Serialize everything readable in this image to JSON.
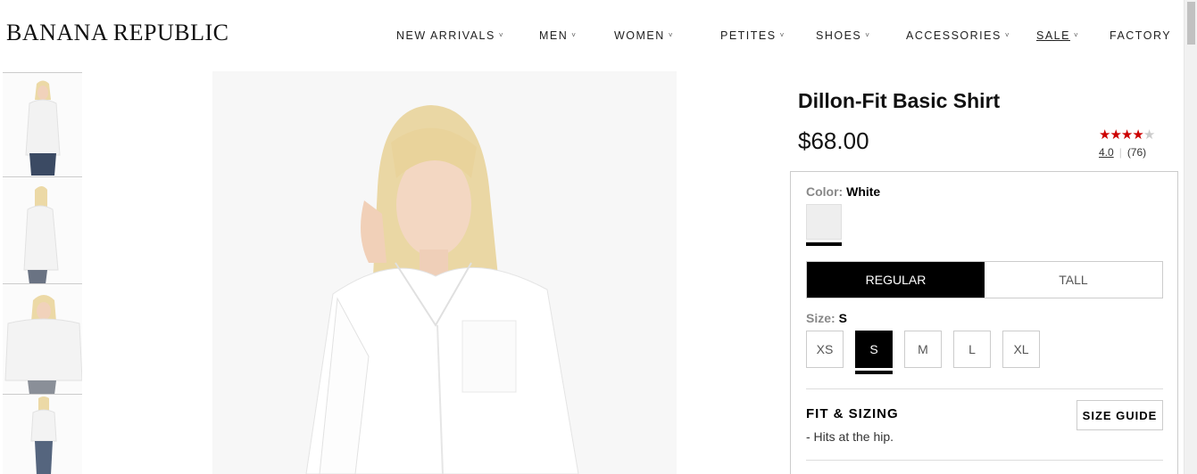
{
  "brand": {
    "logo_text": "BANANA REPUBLIC"
  },
  "nav": {
    "items": [
      {
        "label": "NEW ARRIVALS",
        "has_dropdown": true
      },
      {
        "label": "MEN",
        "has_dropdown": true
      },
      {
        "label": "WOMEN",
        "has_dropdown": true
      },
      {
        "label": "PETITES",
        "has_dropdown": true
      },
      {
        "label": "SHOES",
        "has_dropdown": true
      },
      {
        "label": "ACCESSORIES",
        "has_dropdown": true
      },
      {
        "label": "SALE",
        "has_dropdown": true
      },
      {
        "label": "FACTORY",
        "has_dropdown": false
      }
    ],
    "chevron": "˅"
  },
  "product": {
    "title": "Dillon-Fit Basic Shirt",
    "price": "$68.00",
    "rating": {
      "value": "4.0",
      "count": "(76)",
      "stars_filled": 4,
      "stars_total": 5
    },
    "color": {
      "label": "Color:",
      "value": "White",
      "swatch_color": "#eeeeee"
    },
    "fit_tabs": [
      {
        "label": "REGULAR",
        "selected": true
      },
      {
        "label": "TALL",
        "selected": false
      }
    ],
    "size": {
      "label": "Size:",
      "value": "S"
    },
    "sizes": [
      "XS",
      "S",
      "M",
      "L",
      "XL"
    ],
    "fit_sizing": {
      "heading": "FIT & SIZING",
      "note": "-  Hits at the hip.",
      "size_guide_label": "SIZE GUIDE"
    }
  },
  "colors": {
    "accent": "#000000",
    "star": "#cc0000"
  }
}
